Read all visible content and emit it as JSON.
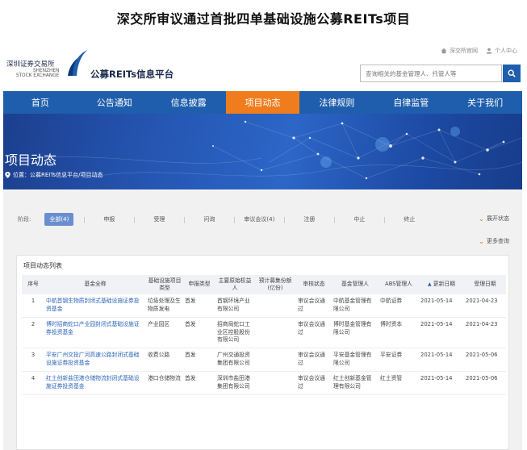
{
  "article_title": "深交所审议通过首批四单基础设施公募REITs项目",
  "header": {
    "util_links": [
      "深交所官网",
      "个人中心"
    ],
    "logo_cn": "深圳证券交易所",
    "logo_en_1": "SHENZHEN",
    "logo_en_2": "STOCK EXCHANGE",
    "platform_name": "公募REITs信息平台",
    "search_placeholder": "查询相关的基金管理人、托管人等"
  },
  "nav": {
    "items": [
      "首页",
      "公告通知",
      "信息披露",
      "项目动态",
      "法律规则",
      "自律监管",
      "关于我们"
    ],
    "active_index": 3
  },
  "banner": {
    "title": "项目动态",
    "breadcrumb": "位置：公募REITs信息平台/项目动态"
  },
  "filter": {
    "label": "阶段:",
    "stages": [
      "全部(4)",
      "申报",
      "受理",
      "问询",
      "审议会议(4)",
      "注册",
      "中止",
      "终止"
    ],
    "active_index": 0,
    "expand_label": "展开状态",
    "more_query_label": "更多查询"
  },
  "list": {
    "title": "项目动态列表",
    "columns": [
      "序号",
      "基金全称",
      "基础设施项目类型",
      "申报类型",
      "主要原始权益人",
      "预计募集份额(亿份)",
      "审核状态",
      "基金管理人",
      "ABS管理人",
      "更新日期",
      "受理日期"
    ],
    "rows": [
      [
        "1",
        "中航首钢生物质封闭式基础设施证券投资基金",
        "垃圾处理及生物质发电",
        "首发",
        "首钢环境产业有限公司",
        "",
        "审议会议通过",
        "中航基金管理有限公司",
        "中航证券",
        "2021-05-14",
        "2021-04-23"
      ],
      [
        "2",
        "博时招商蛇口产业园封闭式基础设施证券投资基金",
        "产业园区",
        "首发",
        "招商局蛇口工业区控股股份有限公司",
        "",
        "审议会议通过",
        "博时基金管理有限公司",
        "博时资本",
        "2021-05-14",
        "2021-04-23"
      ],
      [
        "3",
        "平安广州交投广河高速公路封闭式基础设施证券投资基金",
        "收费公路",
        "首发",
        "广州交通投资集团有限公司",
        "",
        "审议会议通过",
        "平安基金管理有限公司",
        "平安证券",
        "2021-05-14",
        "2021-05-06"
      ],
      [
        "4",
        "红土创新盐田港仓储物流封闭式基础设施证券投资基金",
        "港口仓储物流",
        "首发",
        "深圳市盐田港集团有限公司",
        "",
        "审议会议通过",
        "红土创新基金管理有限公司",
        "红土资管",
        "2021-05-14",
        "2021-05-06"
      ]
    ]
  },
  "colors": {
    "nav_bg": "#1f5eac",
    "nav_active": "#ef7d1e",
    "link": "#2a63b8"
  }
}
